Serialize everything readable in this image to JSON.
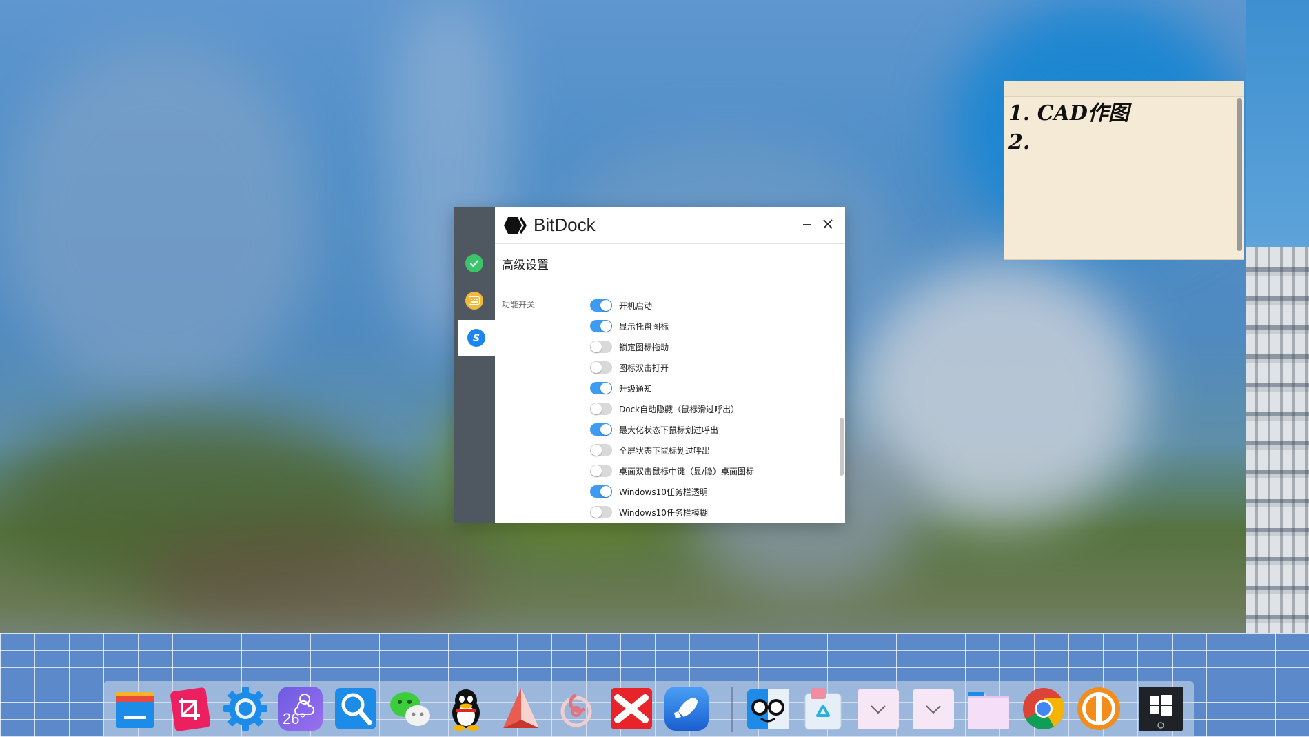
{
  "sticky_note": {
    "text": "1. CAD作图\n2."
  },
  "dialog": {
    "app_name": "BitDock",
    "section_title": "高级设置",
    "group_label": "功能开关",
    "switches": [
      {
        "label": "开机启动",
        "on": true
      },
      {
        "label": "显示托盘图标",
        "on": true
      },
      {
        "label": "锁定图标拖动",
        "on": false
      },
      {
        "label": "图标双击打开",
        "on": false
      },
      {
        "label": "升级通知",
        "on": true
      },
      {
        "label": "Dock自动隐藏（鼠标滑过呼出）",
        "on": false
      },
      {
        "label": "最大化状态下鼠标划过呼出",
        "on": true
      },
      {
        "label": "全屏状态下鼠标划过呼出",
        "on": false
      },
      {
        "label": "桌面双击鼠标中键（显/隐）桌面图标",
        "on": false
      },
      {
        "label": "Windows10任务栏透明",
        "on": true
      },
      {
        "label": "Windows10任务栏模糊",
        "on": false
      }
    ],
    "sidebar": [
      {
        "icon": "check-circle-icon",
        "color": "#3cc46a",
        "active": false
      },
      {
        "icon": "keyboard-icon",
        "color": "#f0b93b",
        "active": false
      },
      {
        "icon": "s-badge-icon",
        "color": "#1b86f0",
        "active": true
      }
    ]
  },
  "dock": {
    "weather_temp": "26°",
    "apps": [
      "file-explorer-icon",
      "crop-tool-icon",
      "system-settings-icon",
      "weather-icon",
      "search-icon",
      "wechat-icon",
      "qq-icon",
      "paper-plane-icon",
      "netease-music-icon",
      "xmind-icon",
      "rocket-launcher-icon",
      "finder-icon",
      "recycle-bin-icon",
      "folder-stack-icon",
      "folder-stack-icon",
      "folder-icon",
      "chrome-icon",
      "power-app-icon",
      "windows-start-icon"
    ]
  },
  "colors": {
    "toggle_on": "#3e9bf2",
    "toggle_off": "#d9d9d9",
    "sidebar_bg": "#4f5861"
  }
}
